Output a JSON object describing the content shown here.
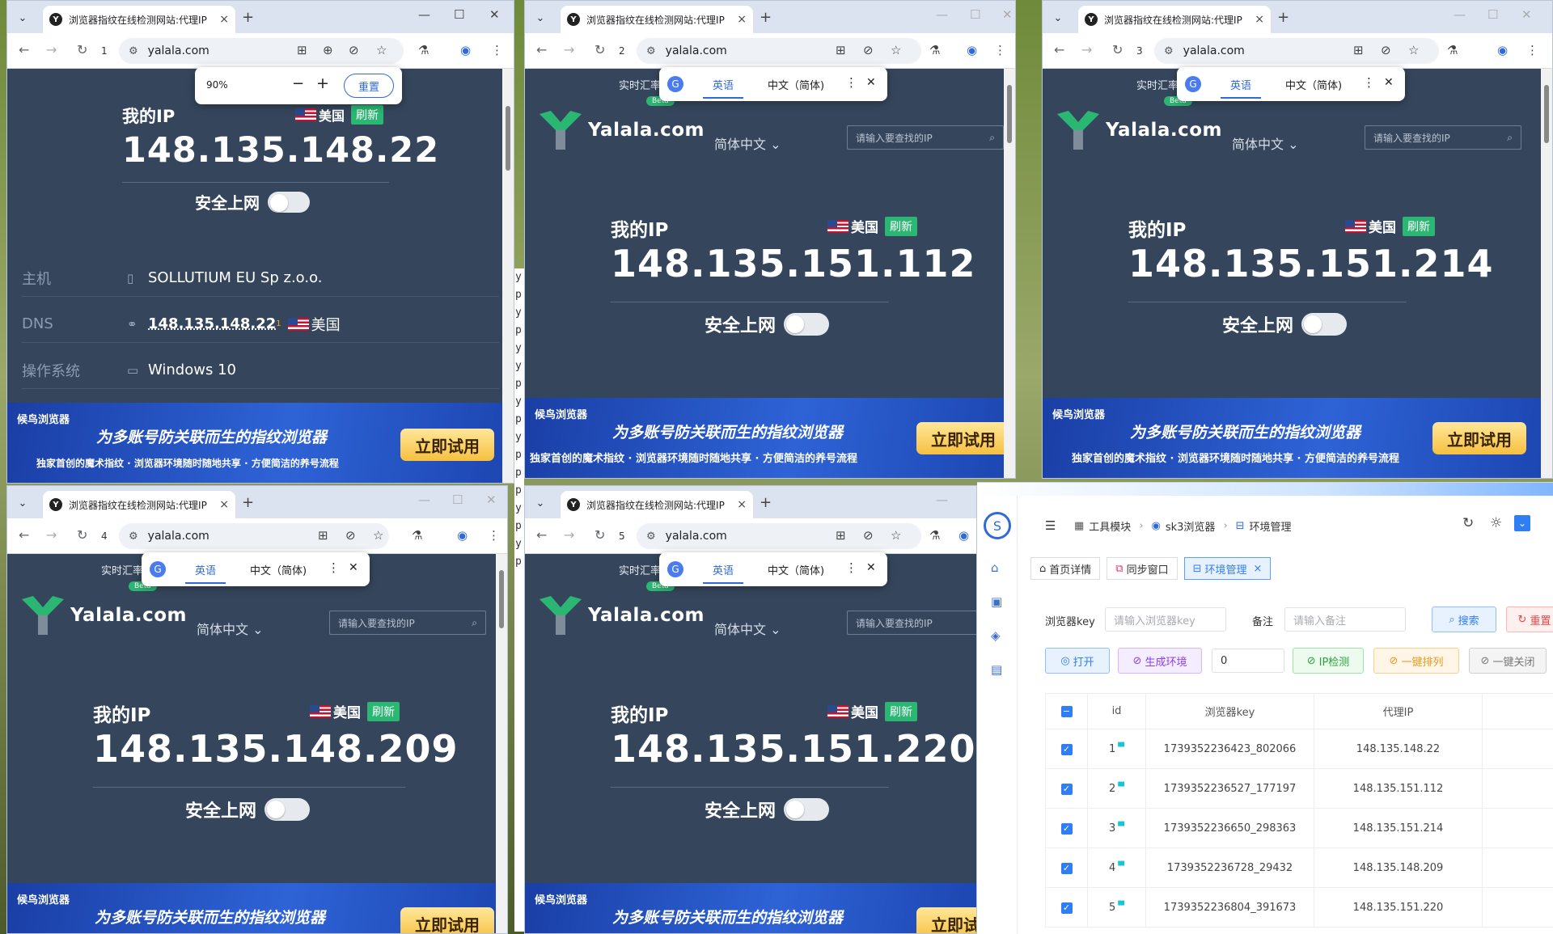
{
  "browser": {
    "tab_title": "浏览器指纹在线检测网站:代理IP",
    "tab_close": "×",
    "new_tab": "+",
    "url": "yalala.com",
    "favicon": "Y",
    "back": "←",
    "forward": "→",
    "reload": "↻",
    "min": "—",
    "max": "☐",
    "close": "✕",
    "dropdown": "⌄"
  },
  "windows": [
    {
      "index": "1",
      "ip": "148.135.148.22"
    },
    {
      "index": "2",
      "ip": "148.135.151.112"
    },
    {
      "index": "3",
      "ip": "148.135.151.214"
    },
    {
      "index": "4",
      "ip": "148.135.148.209"
    },
    {
      "index": "5",
      "ip": "148.135.151.220"
    }
  ],
  "zoom_popup": {
    "level": "90%",
    "minus": "−",
    "plus": "+",
    "reset": "重置"
  },
  "translate_popup": {
    "tab_english": "英语",
    "tab_chinese": "中文（简体)",
    "more": "⋮",
    "close": "✕"
  },
  "site": {
    "ticker": "实时汇率",
    "logo": "Yalala.com",
    "beta": "Beta",
    "lang": "简体中文",
    "search_placeholder": "请输入要查找的IP",
    "my_ip": "我的IP",
    "country": "美国",
    "refresh": "刷新",
    "safe": "安全上网",
    "info": [
      {
        "key": "主机",
        "value": "SOLLUTIUM EU Sp z.o.o."
      },
      {
        "key": "DNS",
        "value": "148.135.148.22",
        "sup": "1",
        "country": "美国"
      },
      {
        "key": "操作系统",
        "value": "Windows 10"
      }
    ],
    "banner": {
      "brand": "候鸟浏览器",
      "headline": "为多账号防关联而生的指纹浏览器",
      "sub": "独家首创的魔术指纹 · 浏览器环境随时随地共享 · 方便简洁的养号流程",
      "cta": "立即试用"
    }
  },
  "admin": {
    "breadcrumb": [
      "工具模块",
      "sk3浏览器",
      "环境管理"
    ],
    "tabs": [
      {
        "label": "首页详情",
        "active": false
      },
      {
        "label": "同步窗口",
        "active": false
      },
      {
        "label": "环境管理",
        "active": true,
        "close": "×"
      }
    ],
    "filters": {
      "key_label": "浏览器key",
      "key_placeholder": "请输入浏览器key",
      "note_label": "备注",
      "note_placeholder": "请输入备注",
      "search": "搜索",
      "reset": "重置"
    },
    "actions": {
      "open": "打开",
      "generate": "生成环境",
      "count": "0",
      "ip_check": "IP检测",
      "arrange": "一键排列",
      "close_all": "一键关闭"
    },
    "columns": [
      "id",
      "浏览器key",
      "代理IP"
    ],
    "rows": [
      {
        "id": "1",
        "key": "1739352236423_802066",
        "ip": "148.135.148.22"
      },
      {
        "id": "2",
        "key": "1739352236527_177197",
        "ip": "148.135.151.112"
      },
      {
        "id": "3",
        "key": "1739352236650_298363",
        "ip": "148.135.151.214"
      },
      {
        "id": "4",
        "key": "1739352236728_29432",
        "ip": "148.135.148.209"
      },
      {
        "id": "5",
        "key": "1739352236804_391673",
        "ip": "148.135.151.220"
      }
    ],
    "colors": {
      "accent": "#2f7ef5",
      "success": "#2bb673"
    }
  },
  "side_text": "y p y p y y p y p y p p p y p y p",
  "colors": {
    "page_bg": "#35465c",
    "tabbar": "#dbe3f1",
    "banner": "#2e63d6"
  }
}
